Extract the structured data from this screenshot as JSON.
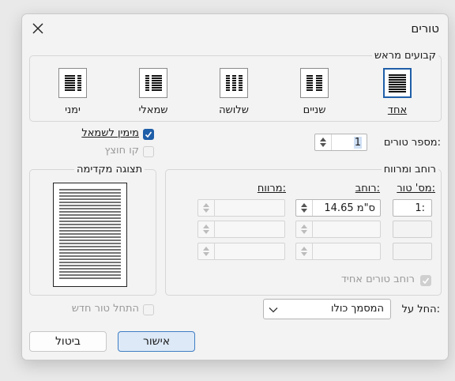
{
  "dialog": {
    "title": "טורים",
    "close_icon": "close-icon"
  },
  "presets": {
    "legend": "קבועים מראש",
    "items": [
      {
        "label": "אחד",
        "icon": "one-column-icon",
        "selected": true
      },
      {
        "label": "שניים",
        "icon": "two-columns-icon",
        "selected": false
      },
      {
        "label": "שלושה",
        "icon": "three-columns-icon",
        "selected": false
      },
      {
        "label": "שמאלי",
        "icon": "left-column-icon",
        "selected": false
      },
      {
        "label": "ימני",
        "icon": "right-column-icon",
        "selected": false
      }
    ]
  },
  "columns_count": {
    "label": "מספר טורים:",
    "value": "1"
  },
  "options": {
    "rtl_label": "מימין לשמאל",
    "rtl_checked": true,
    "line_between_label": "קו חוצץ",
    "line_between_checked": false
  },
  "width_spacing": {
    "legend": "רוחב ומרווח",
    "col_no_header": "מס' טור:",
    "width_header": "רוחב:",
    "spacing_header": "מרווח:",
    "rows": [
      {
        "num": "1:",
        "width": "14.65 ס\"מ",
        "spacing": ""
      },
      {
        "num": "",
        "width": "",
        "spacing": ""
      },
      {
        "num": "",
        "width": "",
        "spacing": ""
      }
    ],
    "equal_width_label": "רוחב טורים אחיד",
    "equal_width_checked": true
  },
  "preview": {
    "legend": "תצוגה מקדימה"
  },
  "apply_to": {
    "label": "החל על:",
    "value": "המסמך כולו"
  },
  "new_column": {
    "label": "התחל טור חדש",
    "checked": false
  },
  "buttons": {
    "ok": "אישור",
    "cancel": "ביטול"
  },
  "colors": {
    "accent": "#1f5ea8",
    "dialog_bg": "#f3f3f3"
  }
}
